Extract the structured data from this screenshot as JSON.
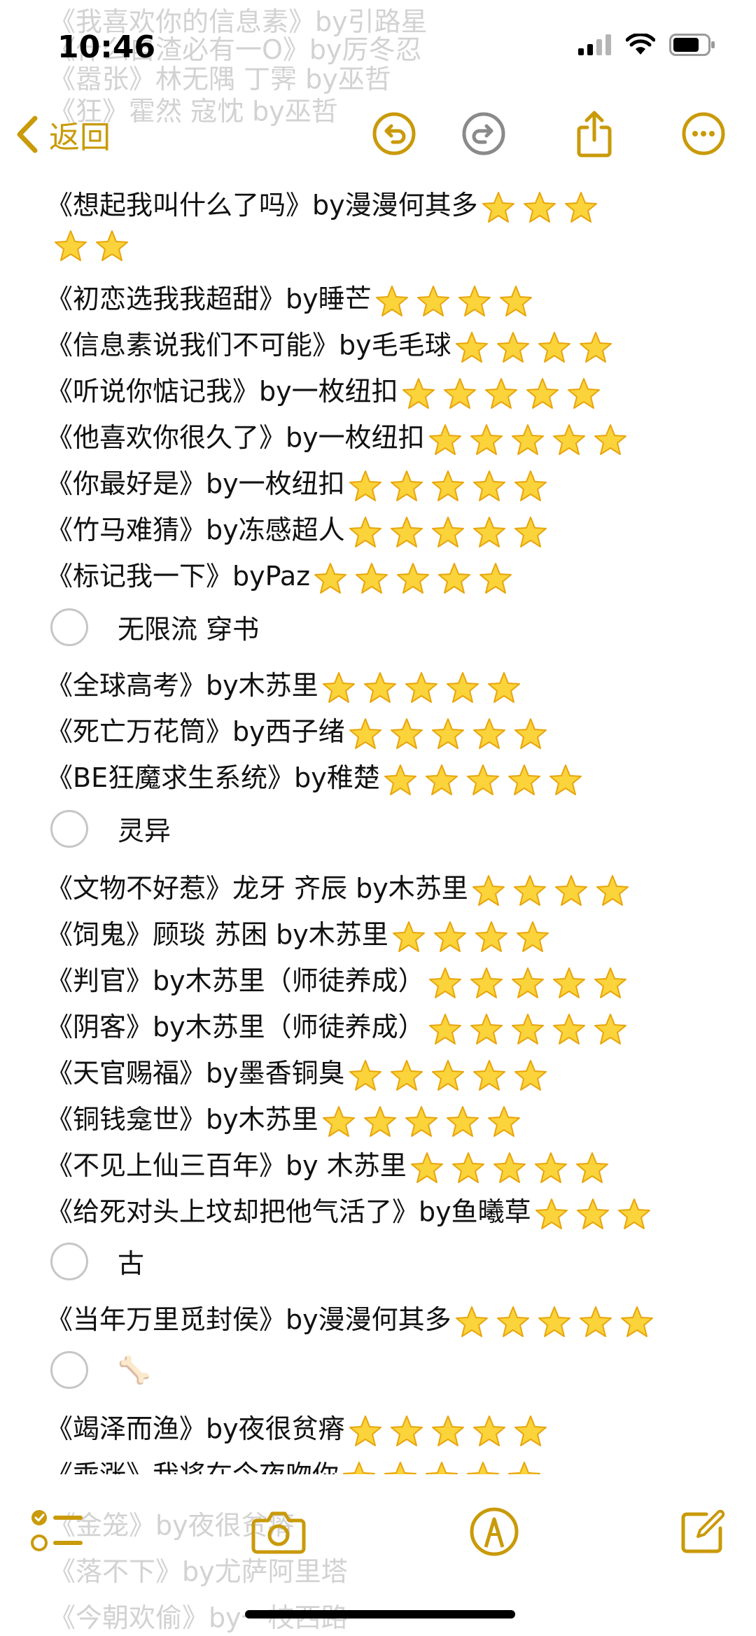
{
  "status": {
    "time": "10:46"
  },
  "nav": {
    "back_label": "返回"
  },
  "behind_text": [
    "《我喜欢你的信息素》by引路星",
    "《什么自渣必有一O》by厉冬忍",
    "《嚣张》林无隅 丁霁 by巫哲",
    "《狂》霍然 寇忱 by巫哲"
  ],
  "lines": [
    {
      "text": "《想起我叫什么了吗》by漫漫何其多",
      "stars": 3
    },
    {
      "text": "",
      "stars": 2
    },
    {
      "text": "《初恋选我我超甜》by睡芒",
      "stars": 4
    },
    {
      "text": "《信息素说我们不可能》by毛毛球",
      "stars": 4
    },
    {
      "text": "《听说你惦记我》by一枚纽扣",
      "stars": 5
    },
    {
      "text": "《他喜欢你很久了》by一枚纽扣",
      "stars": 5
    },
    {
      "text": "《你最好是》by一枚纽扣",
      "stars": 5
    },
    {
      "text": "《竹马难猜》by冻感超人",
      "stars": 5
    },
    {
      "text": "《标记我一下》byPaz",
      "stars": 5
    },
    {
      "heading": "无限流 穿书"
    },
    {
      "text": "《全球高考》by木苏里",
      "stars": 5
    },
    {
      "text": "《死亡万花筒》by西子绪",
      "stars": 5
    },
    {
      "text": "《BE狂魔求生系统》by稚楚",
      "stars": 5
    },
    {
      "heading": "灵异"
    },
    {
      "text": "《文物不好惹》龙牙 齐辰 by木苏里",
      "stars": 4
    },
    {
      "text": "《饲鬼》顾琰 苏困 by木苏里",
      "stars": 4
    },
    {
      "text": "《判官》by木苏里（师徒养成）",
      "stars": 5
    },
    {
      "text": "《阴客》by木苏里（师徒养成）",
      "stars": 5
    },
    {
      "text": "《天官赐福》by墨香铜臭",
      "stars": 5
    },
    {
      "text": "《铜钱龛世》by木苏里",
      "stars": 5
    },
    {
      "text": "《不见上仙三百年》by 木苏里",
      "stars": 5
    },
    {
      "text": "《给死对头上坟却把他气活了》by鱼曦草",
      "stars": 3
    },
    {
      "heading": "古"
    },
    {
      "text": "《当年万里觅封侯》by漫漫何其多",
      "stars": 5
    },
    {
      "heading": "🦴"
    },
    {
      "text": "《竭泽而渔》by夜很贫瘠",
      "stars": 5
    },
    {
      "text": "《乖涨》我将在今夜吻你",
      "stars": 5
    }
  ],
  "behind_toolbar": [
    "《金笼》by夜很贫瘠",
    "《落不下》by尤萨阿里塔",
    "《今朝欢偷》by一枝西路"
  ],
  "colors": {
    "accent": "#c99a09",
    "checkbox": "#c6c6c6"
  }
}
